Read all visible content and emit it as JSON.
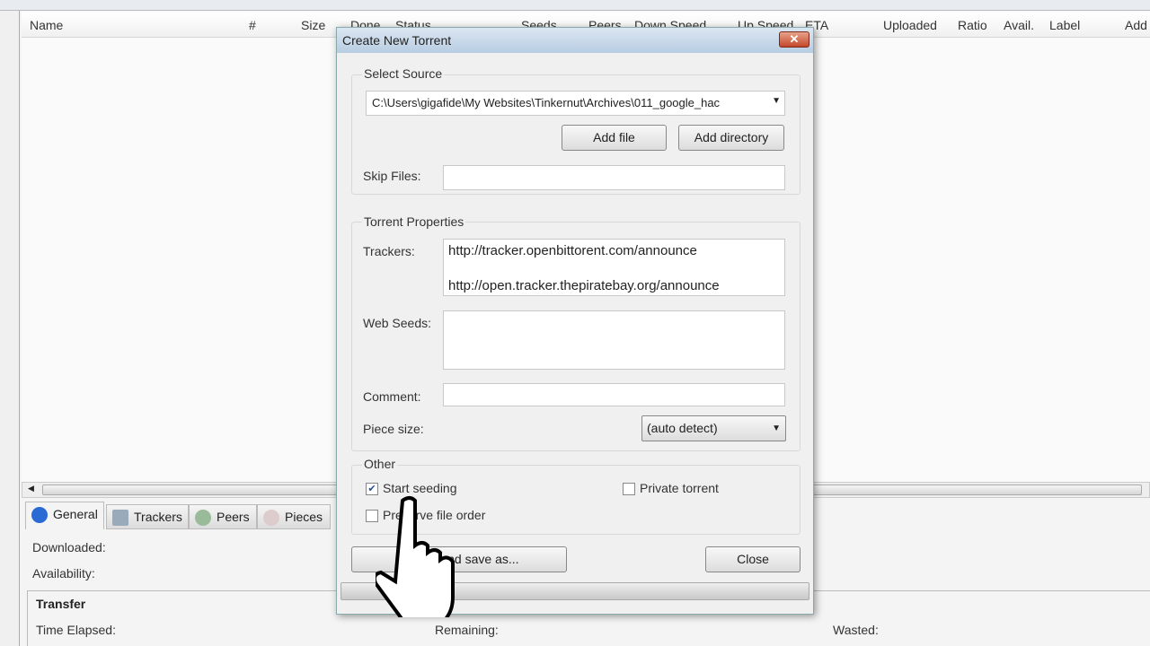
{
  "columns": [
    "Name",
    "#",
    "Size",
    "Done",
    "Status",
    "Seeds",
    "Peers",
    "Down Speed",
    "Up Speed",
    "ETA",
    "Uploaded",
    "Ratio",
    "Avail.",
    "Label",
    "Add"
  ],
  "detail_tabs": [
    {
      "label": "General",
      "icon": "info-icon"
    },
    {
      "label": "Trackers",
      "icon": "trackers-icon"
    },
    {
      "label": "Peers",
      "icon": "peers-icon"
    },
    {
      "label": "Pieces",
      "icon": "pieces-icon"
    }
  ],
  "general": {
    "downloaded": "Downloaded:",
    "availability": "Availability:",
    "transfer": "Transfer",
    "time_elapsed": "Time Elapsed:",
    "remaining": "Remaining:",
    "wasted": "Wasted:"
  },
  "dialog": {
    "title": "Create New Torrent",
    "select_source": "Select Source",
    "source_path": "C:\\Users\\gigafide\\My Websites\\Tinkernut\\Archives\\011_google_hac",
    "add_file": "Add file",
    "add_directory": "Add directory",
    "skip_files_label": "Skip Files:",
    "skip_files_value": "",
    "torrent_properties": "Torrent Properties",
    "trackers_label": "Trackers:",
    "trackers": [
      "http://tracker.openbittorent.com/announce",
      "http://open.tracker.thepiratebay.org/announce"
    ],
    "web_seeds_label": "Web Seeds:",
    "comment_label": "Comment:",
    "piece_size_label": "Piece size:",
    "piece_size_value": "(auto detect)",
    "other": "Other",
    "start_seeding": "Start seeding",
    "start_seeding_checked": true,
    "private_torrent": "Private torrent",
    "private_torrent_checked": false,
    "preserve_order": "Preserve file order",
    "preserve_order_checked": false,
    "create_button": "Create and save as...",
    "close_button": "Close"
  }
}
